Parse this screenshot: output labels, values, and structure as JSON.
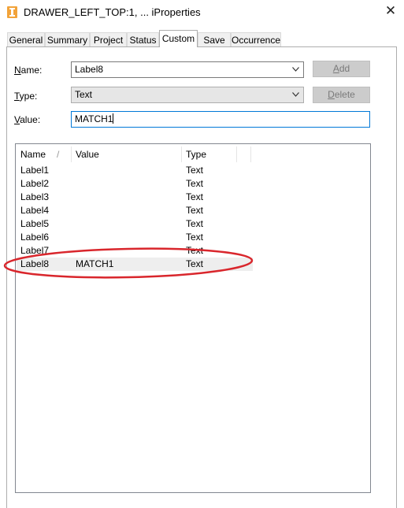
{
  "window": {
    "title": "DRAWER_LEFT_TOP:1, ... iProperties",
    "app_icon": "inventor-app-icon",
    "close_icon": "close-icon",
    "accent_color": "#0078d7",
    "annotation_color": "#d9262c"
  },
  "tabs": [
    "General",
    "Summary",
    "Project",
    "Status",
    "Custom",
    "Save",
    "Occurrence"
  ],
  "active_tab": "Custom",
  "form": {
    "name": {
      "label_first": "N",
      "label_rest": "ame:",
      "value": "Label8"
    },
    "type": {
      "label_first": "T",
      "label_rest": "ype:",
      "value": "Text"
    },
    "value": {
      "label_first": "V",
      "label_rest": "alue:",
      "value": "MATCH1"
    },
    "add_button": {
      "label_first": "A",
      "label_rest": "dd"
    },
    "delete_button": {
      "label_first": "D",
      "label_rest": "elete"
    }
  },
  "table": {
    "columns": [
      "Name",
      "Value",
      "Type"
    ],
    "sort_indicator": "/",
    "rows": [
      {
        "name": "Label1",
        "value": "",
        "type": "Text"
      },
      {
        "name": "Label2",
        "value": "",
        "type": "Text"
      },
      {
        "name": "Label3",
        "value": "",
        "type": "Text"
      },
      {
        "name": "Label4",
        "value": "",
        "type": "Text"
      },
      {
        "name": "Label5",
        "value": "",
        "type": "Text"
      },
      {
        "name": "Label6",
        "value": "",
        "type": "Text"
      },
      {
        "name": "Label7",
        "value": "",
        "type": "Text"
      },
      {
        "name": "Label8",
        "value": "MATCH1",
        "type": "Text"
      }
    ],
    "selected_row": "Label8"
  }
}
